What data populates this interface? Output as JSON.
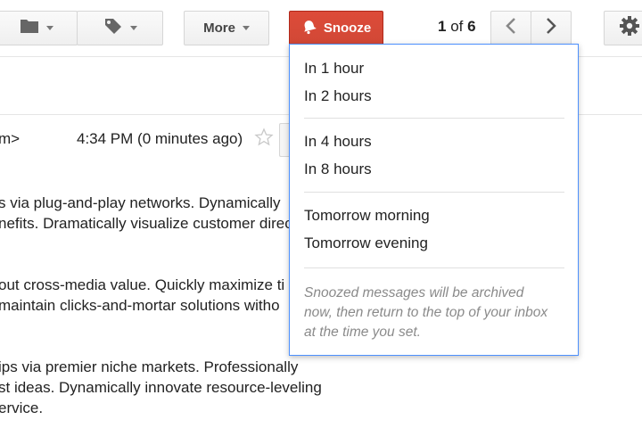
{
  "toolbar": {
    "more_label": "More",
    "snooze_label": "Snooze",
    "pager_current": "1",
    "pager_of": "of",
    "pager_total": "6"
  },
  "icons": [
    "folder-icon",
    "label-tag-icon",
    "bell-icon",
    "chevron-left-icon",
    "chevron-right-icon",
    "gear-icon",
    "star-icon"
  ],
  "colors": {
    "snooze_red": "#d14836",
    "menu_border": "#4d90fe"
  },
  "email": {
    "sender_tail": "m>",
    "timestamp": "4:34 PM (0 minutes ago)",
    "paragraphs": [
      [
        "s via plug-and-play networks. Dynamically",
        "nefits. Dramatically visualize customer direc"
      ],
      [
        "out cross-media value. Quickly maximize ti",
        " maintain clicks-and-mortar solutions witho"
      ],
      [
        "ips via premier niche markets. Professionally",
        "st ideas. Dynamically innovate resource-leveling",
        "ervice."
      ]
    ]
  },
  "snooze_menu": {
    "items": [
      "In 1 hour",
      "In 2 hours",
      "In 4 hours",
      "In 8 hours",
      "Tomorrow morning",
      "Tomorrow evening"
    ],
    "note_lines": [
      "Snoozed messages will be archived",
      "now, then return to the top of your inbox",
      "at the time you set."
    ]
  }
}
